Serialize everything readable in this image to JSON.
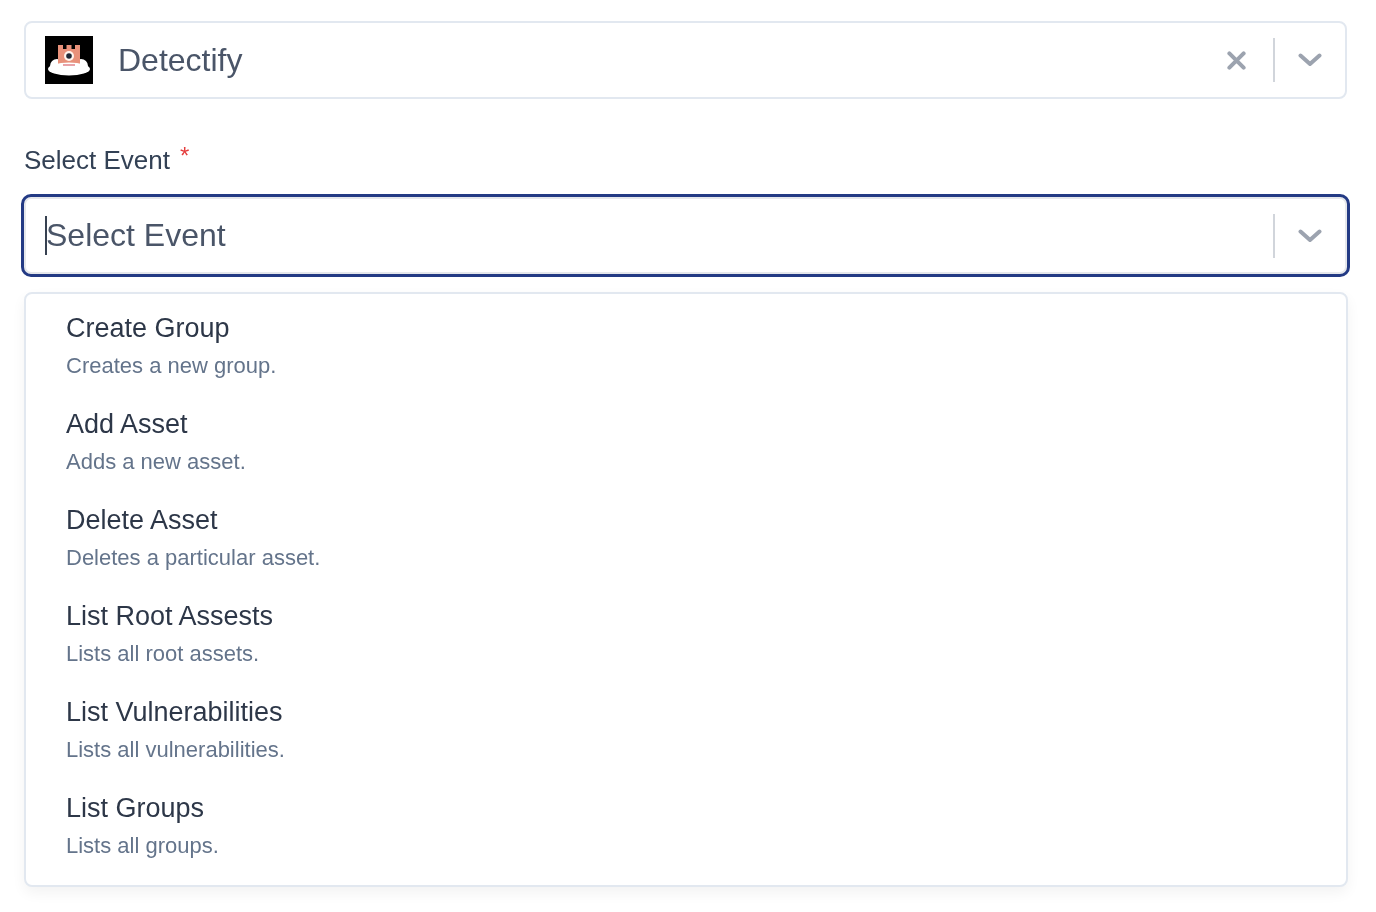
{
  "connection_select": {
    "value": "Detectify",
    "clearable": true
  },
  "event_field": {
    "label": "Select Event",
    "required_mark": "*",
    "placeholder": "Select Event",
    "focused": true,
    "expanded": true
  },
  "options": [
    {
      "title": "Create Group",
      "description": "Creates a new group.",
      "selected": false
    },
    {
      "title": "Add Asset",
      "description": "Adds a new asset.",
      "selected": false
    },
    {
      "title": "Delete Asset",
      "description": "Deletes a particular asset.",
      "selected": false
    },
    {
      "title": "List Root Assests",
      "description": "Lists all root assets.",
      "selected": false
    },
    {
      "title": "List Vulnerabilities",
      "description": "Lists all vulnerabilities.",
      "selected": false
    },
    {
      "title": "List Groups",
      "description": "Lists all groups.",
      "selected": false
    }
  ]
}
